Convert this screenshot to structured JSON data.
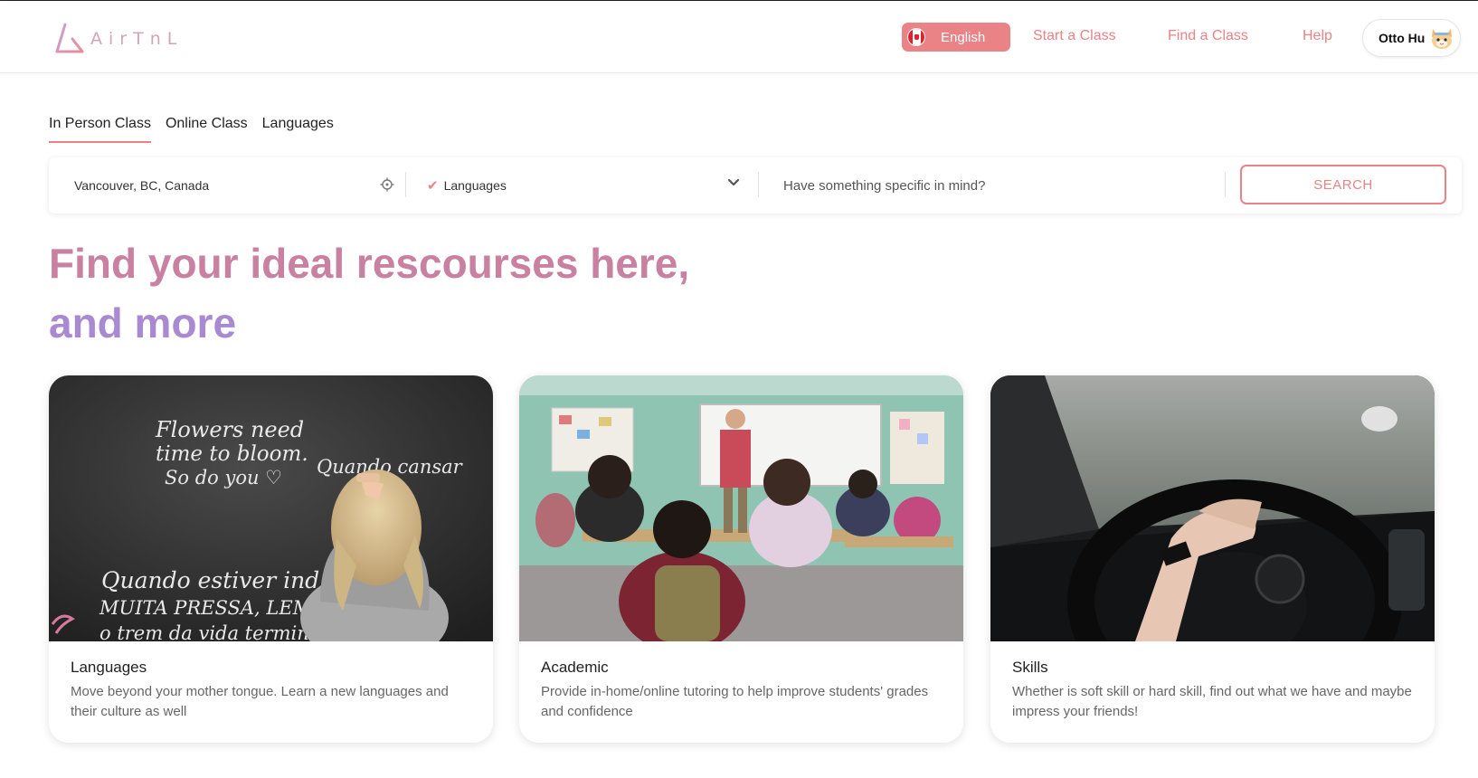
{
  "brand": {
    "logo_text": "AirTnL"
  },
  "header": {
    "language_label": "English",
    "nav": {
      "start_class": "Start a Class",
      "find_class": "Find a Class",
      "help": "Help"
    },
    "user_name": "Otto Hu"
  },
  "tabs": [
    {
      "label": "In Person Class",
      "active": true
    },
    {
      "label": "Online Class",
      "active": false
    },
    {
      "label": "Languages",
      "active": false
    }
  ],
  "search": {
    "location_value": "Vancouver, BC, Canada",
    "category_value": "Languages",
    "keyword_placeholder": "Have something specific in mind?",
    "button_label": "SEARCH"
  },
  "hero": {
    "line1": "Find your ideal rescourses here,",
    "line2": "and more"
  },
  "cards": [
    {
      "title": "Languages",
      "description": "Move beyond your mother tongue. Learn a new languages and their culture as well",
      "chalk_lines": [
        "Flowers need",
        "time to bloom.",
        "So do you ♡",
        "Quando cansar",
        "Quando estiver ind",
        "MUITA PRESSA, LEMBRE",
        "o trem da vida termina"
      ]
    },
    {
      "title": "Academic",
      "description": "Provide in-home/online tutoring to help improve students' grades and confidence"
    },
    {
      "title": "Skills",
      "description": "Whether is soft skill or hard skill, find out what we have and maybe impress your friends!"
    }
  ],
  "colors": {
    "accent": "#e98386",
    "headline_pink": "#c981a2",
    "headline_purple": "#a98ad2"
  }
}
